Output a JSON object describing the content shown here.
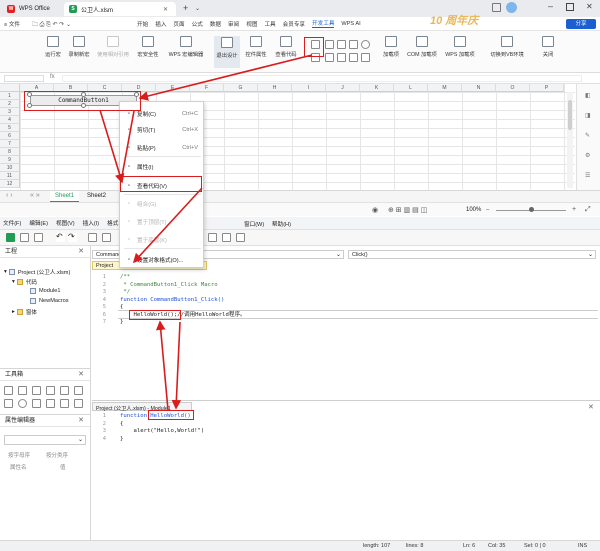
{
  "titlebar": {
    "app_tab": "WPS Office",
    "doc_tab": "公卫人.xlsm",
    "new_tab": "+"
  },
  "ribbon_tabs": [
    "≡ 文件",
    "开始",
    "插入",
    "页面",
    "公式",
    "数据",
    "审阅",
    "视图",
    "工具",
    "会员专享",
    "开发工具",
    "WPS AI"
  ],
  "ribbon_active": "开发工具",
  "banner_text": "10 周年庆",
  "share_label": "分享",
  "ribbon_buttons": {
    "run_macro": "运行宏",
    "record_macro": "录制新宏",
    "relative_ref": "使用相对引用",
    "macro_security": "宏安全性",
    "wps_macro_editor": "WPS 宏编辑器",
    "exit_design": "退出设计",
    "control_props": "控件属性",
    "view_code": "查看代码",
    "load_items": "加载项",
    "com_addins": "COM 加载项",
    "wps_addins": "WPS 加载项",
    "switch_vb": "切换到VB环境",
    "close": "关闭"
  },
  "grid": {
    "columns": [
      "A",
      "B",
      "C",
      "D",
      "E",
      "F",
      "G",
      "H",
      "I",
      "J",
      "K",
      "L",
      "M",
      "N",
      "O",
      "P"
    ],
    "rows": [
      "1",
      "2",
      "3",
      "4",
      "5",
      "6",
      "7",
      "8",
      "9",
      "10",
      "11",
      "12"
    ],
    "command_button_label": "CommandButton1"
  },
  "sheet_tabs": [
    "Sheet1",
    "Sheet2"
  ],
  "zoom_level": "100%",
  "context_menu": {
    "items": [
      {
        "label": "复制(C)",
        "shortcut": "Ctrl+C",
        "icon": "copy-icon",
        "disabled": false
      },
      {
        "label": "剪切(T)",
        "shortcut": "Ctrl+X",
        "icon": "cut-icon",
        "disabled": false
      },
      {
        "label": "粘贴(P)",
        "shortcut": "Ctrl+V",
        "icon": "paste-icon",
        "disabled": false
      },
      {
        "label": "属性(I)",
        "shortcut": "",
        "icon": "properties-icon",
        "disabled": false
      },
      {
        "label": "查看代码(V)",
        "shortcut": "",
        "icon": "view-code-icon",
        "disabled": false
      },
      {
        "label": "组合(G)",
        "shortcut": "",
        "icon": "group-icon",
        "disabled": true
      },
      {
        "label": "置于顶层(T)",
        "shortcut": "",
        "icon": "bring-front-icon",
        "disabled": true
      },
      {
        "label": "置于底层(K)",
        "shortcut": "",
        "icon": "send-back-icon",
        "disabled": true
      },
      {
        "label": "设置对象格式(O)...",
        "shortcut": "",
        "icon": "format-icon",
        "disabled": false
      }
    ]
  },
  "vbe_menu": [
    "文件(F)",
    "编辑(E)",
    "视图(V)",
    "插入(I)",
    "格式",
    "窗口(W)",
    "帮助(H)"
  ],
  "project_panel": {
    "title": "工程",
    "root": "Project (公卫人.xlsm)",
    "folder": "代码",
    "modules": [
      "Module1",
      "NewMacros"
    ],
    "other": "窗体"
  },
  "toolbox_title": "工具箱",
  "property_panel": {
    "title": "属性编辑器",
    "tab_alpha": "按字母序",
    "tab_category": "按分类序",
    "col_name": "属性名",
    "col_value": "值"
  },
  "code_window1": {
    "object_dropdown": "CommandButton1",
    "proc_dropdown": "Click()",
    "tab_label": "Project",
    "lines": [
      {
        "n": "1",
        "text": "/**"
      },
      {
        "n": "2",
        "text": " * CommandButton1_Click Macro"
      },
      {
        "n": "3",
        "text": " */"
      },
      {
        "n": "4",
        "text": "function CommandButton1_Click()"
      },
      {
        "n": "5",
        "text": "{"
      },
      {
        "n": "6",
        "text": "    HelloWorld();//调用HelloWorld程序。"
      },
      {
        "n": "7",
        "text": "}"
      }
    ]
  },
  "code_window2": {
    "tab_label": "Project (公卫人.xlsm) - Module1",
    "lines": [
      {
        "n": "1",
        "text": "function HelloWorld()"
      },
      {
        "n": "2",
        "text": "{"
      },
      {
        "n": "3",
        "text": "    alert(\"Hello,World!\")"
      },
      {
        "n": "4",
        "text": "}"
      }
    ]
  },
  "status": {
    "length": "length: 107",
    "lines": "lines: 8",
    "ln": "Ln: 6",
    "col": "Col: 35",
    "sel": "Sel: 0 | 0",
    "ins": "INS"
  },
  "colors": {
    "accent": "#1a5fd0",
    "annotation_red": "#d91d1d",
    "title_bg": "#e9ebef"
  }
}
